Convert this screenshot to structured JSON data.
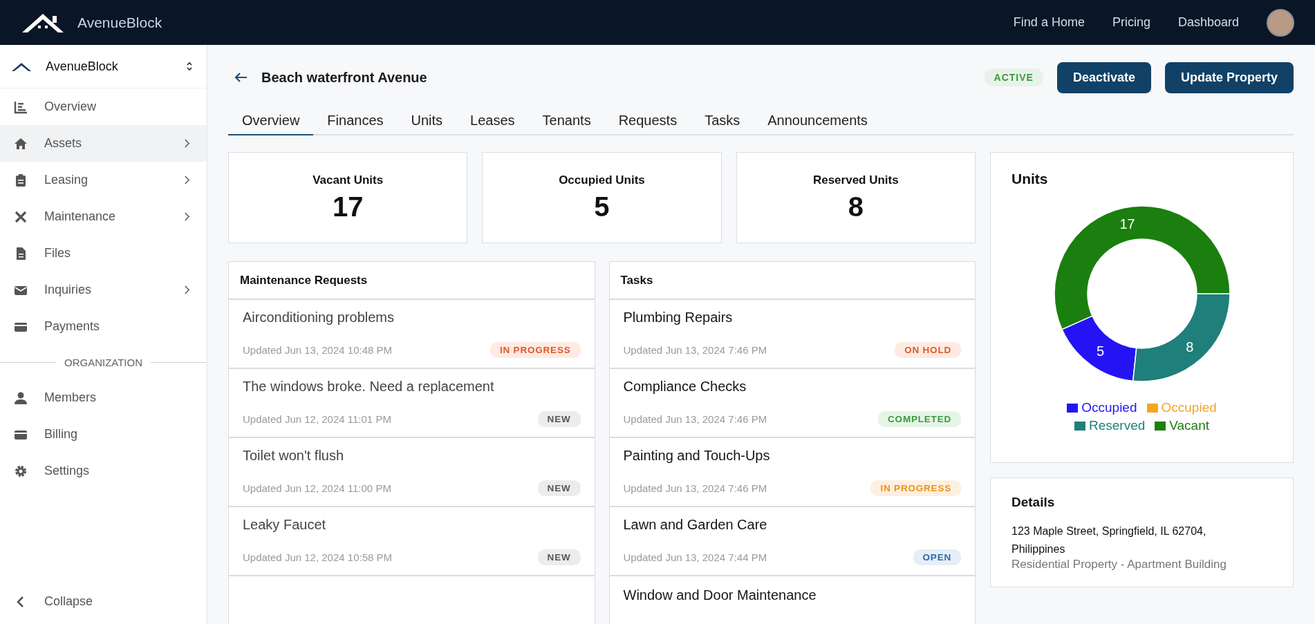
{
  "topbar": {
    "brand": "AvenueBlock",
    "nav": [
      "Find a Home",
      "Pricing",
      "Dashboard"
    ]
  },
  "sidebar": {
    "workspace": "AvenueBlock",
    "items": [
      {
        "label": "Overview",
        "submenu": false,
        "selected": false
      },
      {
        "label": "Assets",
        "submenu": true,
        "selected": true
      },
      {
        "label": "Leasing",
        "submenu": true,
        "selected": false
      },
      {
        "label": "Maintenance",
        "submenu": true,
        "selected": false
      },
      {
        "label": "Files",
        "submenu": false,
        "selected": false
      },
      {
        "label": "Inquiries",
        "submenu": true,
        "selected": false
      },
      {
        "label": "Payments",
        "submenu": false,
        "selected": false
      }
    ],
    "section_label": "ORGANIZATION",
    "org_items": [
      {
        "label": "Members",
        "selected": false
      },
      {
        "label": "Billing",
        "selected": false
      },
      {
        "label": "Settings",
        "selected": false
      }
    ],
    "collapse": "Collapse"
  },
  "header": {
    "title": "Beach waterfront Avenue",
    "status": "ACTIVE",
    "buttons": [
      "Deactivate",
      "Update Property"
    ]
  },
  "tabs": [
    {
      "label": "Overview",
      "selected": true
    },
    {
      "label": "Finances",
      "selected": false
    },
    {
      "label": "Units",
      "selected": false
    },
    {
      "label": "Leases",
      "selected": false
    },
    {
      "label": "Tenants",
      "selected": false
    },
    {
      "label": "Requests",
      "selected": false
    },
    {
      "label": "Tasks",
      "selected": false
    },
    {
      "label": "Announcements",
      "selected": false
    }
  ],
  "stats": [
    {
      "label": "Vacant Units",
      "value": "17"
    },
    {
      "label": "Occupied Units",
      "value": "5"
    },
    {
      "label": "Reserved Units",
      "value": "8"
    }
  ],
  "maintenance": {
    "title": "Maintenance Requests",
    "rows": [
      {
        "title": "Airconditioning problems",
        "updated": "Updated Jun 13, 2024 10:48 PM",
        "status": "IN PROGRESS",
        "kind": "in_progress"
      },
      {
        "title": "The windows broke. Need a replacement",
        "updated": "Updated Jun 12, 2024 11:01 PM",
        "status": "NEW",
        "kind": "new"
      },
      {
        "title": "Toilet won't flush",
        "updated": "Updated Jun 12, 2024 11:00 PM",
        "status": "NEW",
        "kind": "new"
      },
      {
        "title": "Leaky Faucet",
        "updated": "Updated Jun 12, 2024 10:58 PM",
        "status": "NEW",
        "kind": "new"
      }
    ]
  },
  "tasks": {
    "title": "Tasks",
    "rows": [
      {
        "title": "Plumbing Repairs",
        "updated": "Updated Jun 13, 2024 7:46 PM",
        "status": "ON HOLD",
        "kind": "on_hold"
      },
      {
        "title": "Compliance Checks",
        "updated": "Updated Jun 13, 2024 7:46 PM",
        "status": "COMPLETED",
        "kind": "completed"
      },
      {
        "title": "Painting and Touch-Ups",
        "updated": "Updated Jun 13, 2024 7:46 PM",
        "status": "IN PROGRESS",
        "kind": "in_progress_task"
      },
      {
        "title": "Lawn and Garden Care",
        "updated": "Updated Jun 13, 2024 7:44 PM",
        "status": "OPEN",
        "kind": "open"
      },
      {
        "title": "Window and Door Maintenance"
      }
    ]
  },
  "units": {
    "title": "Units",
    "chart_data": {
      "type": "donut",
      "categories": [
        "Occupied",
        "Occupied",
        "Reserved",
        "Vacant"
      ],
      "values": [
        5,
        0,
        8,
        17
      ],
      "colors": [
        "#2414f5",
        "#f5a623",
        "#1f7f7a",
        "#1a7f0e"
      ],
      "data_labels": true
    }
  },
  "details": {
    "title": "Details",
    "address": "123 Maple Street, Springfield, IL 62704, Philippines",
    "type": "Residential Property - Apartment Building"
  }
}
